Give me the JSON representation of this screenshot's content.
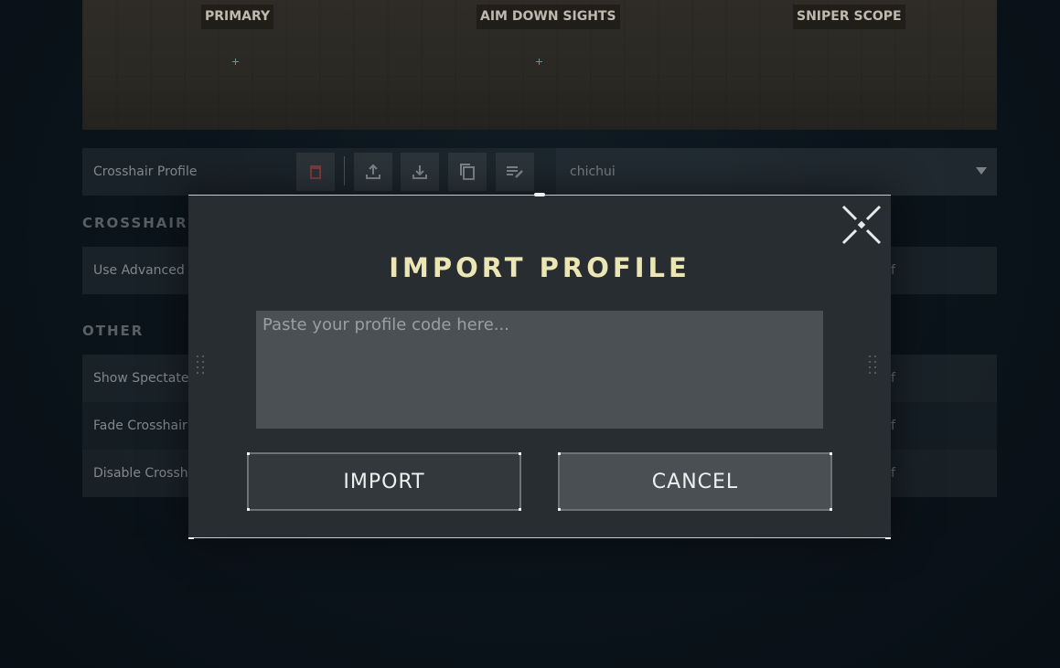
{
  "preview": {
    "labels": [
      "PRIMARY",
      "AIM DOWN SIGHTS",
      "SNIPER SCOPE"
    ]
  },
  "profile_bar": {
    "label": "Crosshair Profile",
    "selected_profile": "chichui",
    "icons": [
      "delete-icon",
      "export-icon",
      "import-icon",
      "copy-icon",
      "rename-icon"
    ]
  },
  "sections": {
    "crosshair": {
      "title": "CROSSHAIR",
      "rows": [
        {
          "label": "Use Advanced O",
          "value": "f"
        }
      ]
    },
    "other": {
      "title": "OTHER",
      "rows": [
        {
          "label": "Show Spectated",
          "value": "f"
        },
        {
          "label": "Fade Crosshair V",
          "value": "f"
        },
        {
          "label": "Disable Crossha",
          "value": "f"
        }
      ]
    }
  },
  "modal": {
    "title": "IMPORT PROFILE",
    "input_placeholder": "Paste your profile code here...",
    "input_value": "",
    "import_label": "IMPORT",
    "cancel_label": "CANCEL"
  },
  "colors": {
    "title": "#ece5b4",
    "reticle": "#18b8a6",
    "delete_icon": "#b0504c"
  }
}
